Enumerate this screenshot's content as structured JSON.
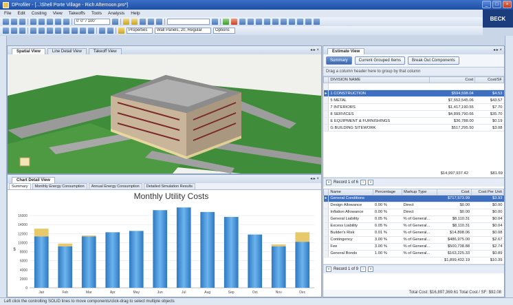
{
  "window": {
    "title": "DProfiler - [...\\Shell Porte Village - Rich Afternoon.pro*]",
    "brand": "BECK"
  },
  "menu": [
    "File",
    "Edit",
    "Costing",
    "View",
    "Takeoffs",
    "Tools",
    "Analysis",
    "Help"
  ],
  "toolbar": {
    "zoom_value": "0' 0\" / 100'",
    "property_label": "Properties",
    "property_value": "Wall Panels, 20, Regular",
    "options_label": "Options"
  },
  "spatial": {
    "tabs": [
      "Spatial View",
      "Line Detail View",
      "Takeoff View"
    ],
    "active_tab": "Spatial View"
  },
  "chart_panel": {
    "tab": "Chart Detail View",
    "subtabs": [
      "Summary",
      "Monthly Energy Consumption",
      "Annual Energy Consumption",
      "Detailed Simulation Results"
    ],
    "active_subtab": "Summary"
  },
  "chart_data": {
    "type": "bar",
    "title": "Monthly Utility Costs",
    "categories": [
      "Jan",
      "Feb",
      "Mar",
      "Apr",
      "May",
      "Jun",
      "Jul",
      "Aug",
      "Sep",
      "Oct",
      "Nov",
      "Dec"
    ],
    "series": [
      {
        "values": [
          11400,
          9200,
          11400,
          12300,
          12600,
          17200,
          17800,
          16800,
          15700,
          11800,
          9200,
          10200
        ]
      },
      {
        "values": [
          1700,
          600,
          200,
          0,
          0,
          0,
          0,
          0,
          0,
          0,
          400,
          2100
        ]
      }
    ],
    "yticks": [
      "0",
      "2000",
      "4000",
      "6000",
      "8000",
      "10000",
      "12000",
      "14000",
      "16000"
    ],
    "ylabel": "$",
    "ylim": [
      0,
      18000
    ],
    "colors": [
      "#3a8fd4",
      "#e8c96a"
    ]
  },
  "estimate": {
    "tab": "Estimate View",
    "buttons": [
      "Summary",
      "Current Grouped Items",
      "Break Out Components"
    ],
    "active_button": "Summary",
    "group_hint": "Drag a column header here to group by that column",
    "columns": [
      "DIVISION NAME",
      "Cost",
      "Cost/SF"
    ],
    "rows": [
      {
        "name": "1 CONSTRUCTION",
        "cost": "$594,598.04",
        "cost_sf": "$4.53"
      },
      {
        "name": "5 METAL",
        "cost": "$7,552,545.06",
        "cost_sf": "$43.57"
      },
      {
        "name": "7 INTERIORS",
        "cost": "$1,417,190.55",
        "cost_sf": "$7.70"
      },
      {
        "name": "8 SERVICES",
        "cost": "$4,899,790.66",
        "cost_sf": "$35.70"
      },
      {
        "name": "E EQUIPMENT & FURNISHINGS",
        "cost": "$36,788.00",
        "cost_sf": "$0.19"
      },
      {
        "name": "G BUILDING SITEWORK",
        "cost": "$517,295.50",
        "cost_sf": "$3.08"
      }
    ],
    "sum_cost": "$14,997,937.42",
    "sum_cost_sf": "$81.69",
    "pager1": "Record 1 of 6",
    "markup_columns": [
      "Name",
      "Percentage",
      "Markup Type",
      "Cost",
      "Cost Per Unit"
    ],
    "markup_rows": [
      {
        "name": "General Conditions",
        "pct": "",
        "type": "",
        "cost": "$717,573.99",
        "cpu": "$3.93"
      },
      {
        "name": "Design Allowance",
        "pct": "0.00 %",
        "type": "Direct",
        "cost": "$0.00",
        "cpu": "$0.00"
      },
      {
        "name": "Inflation Allowance",
        "pct": "0.00 %",
        "type": "Direct",
        "cost": "$0.00",
        "cpu": "$0.00"
      },
      {
        "name": "General Liability",
        "pct": "0.05 %",
        "type": "% of General...",
        "cost": "$8,110.31",
        "cpu": "$0.04"
      },
      {
        "name": "Excess Liability",
        "pct": "0.05 %",
        "type": "% of General...",
        "cost": "$8,110.31",
        "cpu": "$0.04"
      },
      {
        "name": "Builder's Risk",
        "pct": "0.01 %",
        "type": "% of General...",
        "cost": "$14,898.06",
        "cpu": "$0.08"
      },
      {
        "name": "Contingency",
        "pct": "3.00 %",
        "type": "% of General...",
        "cost": "$486,975.00",
        "cpu": "$2.67"
      },
      {
        "name": "Fee",
        "pct": "3.00 %",
        "type": "% of General...",
        "cost": "$500,738.88",
        "cpu": "$2.74"
      },
      {
        "name": "General Bonds",
        "pct": "1.00 %",
        "type": "% of General...",
        "cost": "$163,225.33",
        "cpu": "$0.89"
      }
    ],
    "sum2_cost": "$1,899,432.19",
    "sum2_cpu": "$10.39",
    "pager2": "Record 1 of 9",
    "totals_text": "Total Cost: $16,897,369.61    Total Cost / SF: $92.08"
  },
  "status": "Left click the controlling SOLID lines to move components/click-drag to select multiple objects"
}
